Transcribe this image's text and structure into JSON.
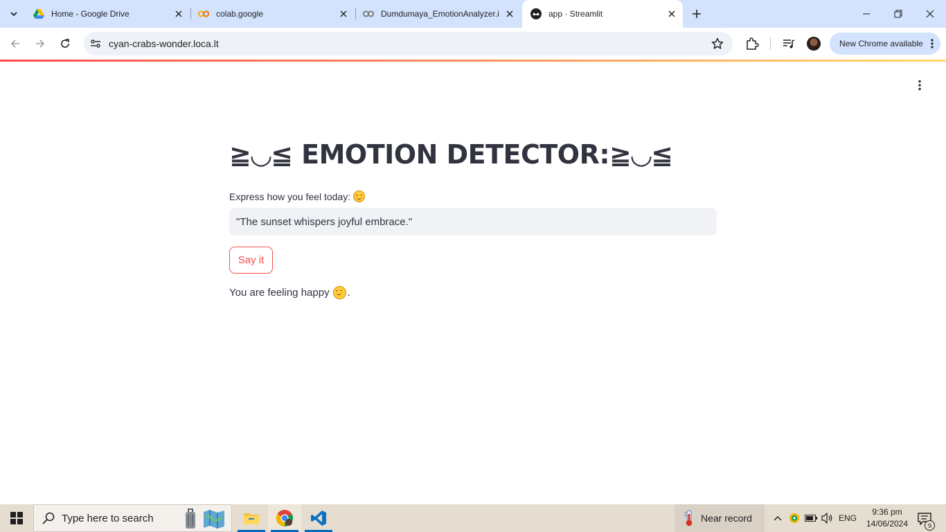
{
  "browser": {
    "tabs": [
      {
        "title": "Home - Google Drive",
        "icon": "google-drive-icon"
      },
      {
        "title": "colab.google",
        "icon": "colab-icon"
      },
      {
        "title": "Dumdumaya_EmotionAnalyzer.i",
        "icon": "colab-grey-icon"
      },
      {
        "title": "app · Streamlit",
        "icon": "streamlit-icon",
        "active": true
      }
    ],
    "url": "cyan-crabs-wonder.loca.lt",
    "update_chip": "New Chrome available"
  },
  "app": {
    "title": "≧◡≦ EMOTION DETECTOR:≧◡≦",
    "input_label": "Express how you feel today:",
    "input_value": "\"The sunset whispers joyful embrace.\"",
    "button_label": "Say it",
    "result_prefix": "You are feeling happy",
    "result_suffix": ".",
    "accent_color": "#ff4b4b"
  },
  "taskbar": {
    "search_placeholder": "Type here to search",
    "weather_text": "Near record",
    "language": "ENG",
    "time": "9:36 pm",
    "date": "14/06/2024",
    "notification_count": "9"
  }
}
